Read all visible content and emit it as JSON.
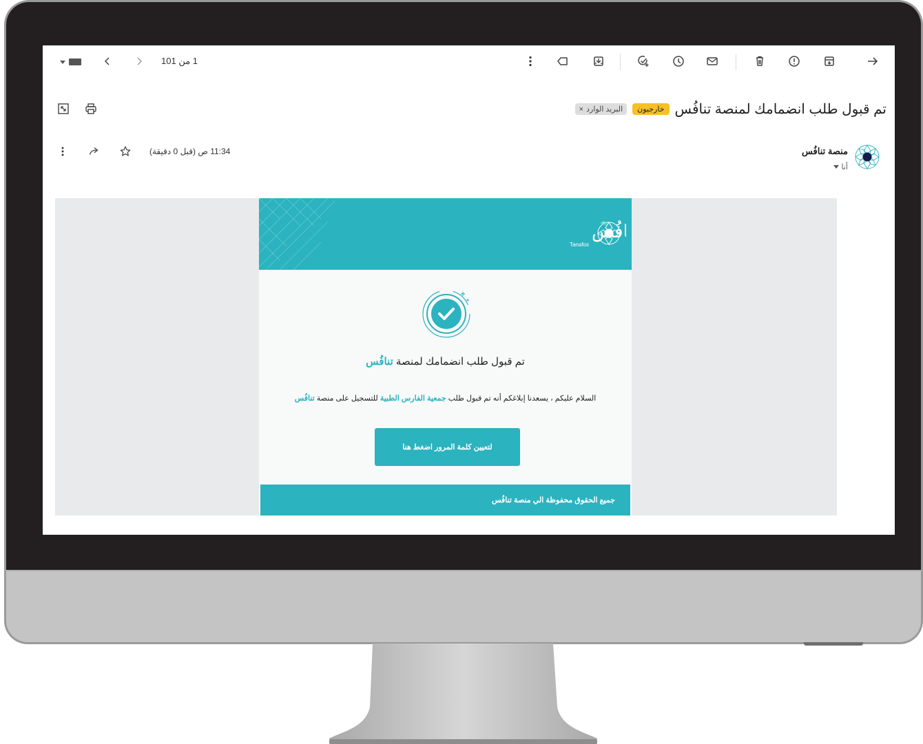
{
  "toolbar": {
    "pager": "1 من 101"
  },
  "subject": {
    "title": "تم قبول طلب انضمامك لمنصة تنافُس",
    "tag_external": "خارجيون",
    "tag_inbox": "البريد الوارد"
  },
  "sender": {
    "name": "منصة تنافُس",
    "to": "أنا",
    "date": "11:34 ص (قبل 0 دقيقة)"
  },
  "email": {
    "logo_text": "تنافُس",
    "logo_sub": "Tanafos",
    "title_prefix": "تم قبول طلب انضمامك لمنصة",
    "title_brand": "تنافُس",
    "msg_part1": "السلام عليكم ، يسعدنا إبلاغكم أنه تم قبول طلب",
    "msg_org": "جمعية الفارس الطبية",
    "msg_part2": "للتسجيل على منصة",
    "msg_brand": "تنافُس",
    "cta_label": "لتعيين كلمة المرور اضغط هنا",
    "footer": "جميع الحقوق محفوظة الي منصة تنافُس"
  },
  "colors": {
    "brand": "#2bb3bf",
    "tag_external": "#f6c026"
  },
  "icons": [
    "back-arrow-icon",
    "archive-icon",
    "report-spam-icon",
    "delete-icon",
    "mark-unread-icon",
    "snooze-icon",
    "add-task-icon",
    "move-to-icon",
    "label-icon",
    "more-vert-icon",
    "print-icon",
    "open-new-window-icon",
    "star-icon",
    "forward-icon",
    "prev-icon",
    "next-icon",
    "keyboard-icon"
  ]
}
